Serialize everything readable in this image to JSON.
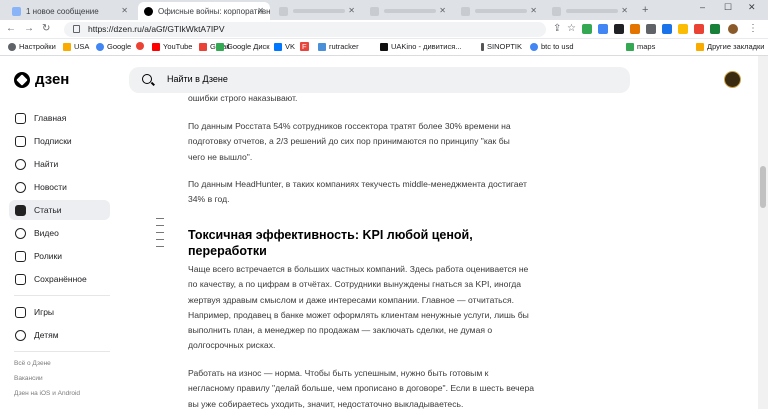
{
  "browser": {
    "tabs": [
      {
        "title": "1 новое сообщение",
        "favicon_color": "#8ab4f8"
      },
      {
        "title": "Офисные войны: корпоративн",
        "favicon_color": "#000000"
      },
      {
        "title": "",
        "favicon_color": "#9aa0a6"
      },
      {
        "title": "",
        "favicon_color": "#9aa0a6"
      },
      {
        "title": "",
        "favicon_color": "#9aa0a6"
      },
      {
        "title": "",
        "favicon_color": "#9aa0a6"
      }
    ],
    "new_tab": "+",
    "window_controls": {
      "minimize": "–",
      "maximize": "☐",
      "close": "✕"
    },
    "url": "https://dzen.ru/a/aGf/GTIkWktA7IPV",
    "bookmarks": [
      {
        "label": "Настройки",
        "color": "#5f6368"
      },
      {
        "label": "USA",
        "color": "#f9ab00"
      },
      {
        "label": "Google",
        "color": "#4285f4"
      },
      {
        "label": "",
        "color": "#ea4335"
      },
      {
        "label": "YouTube",
        "color": "#ff0000"
      },
      {
        "label": "Gmail",
        "color": "#ea4335"
      },
      {
        "label": "Google Диск",
        "color": "#34a853"
      },
      {
        "label": "VK",
        "color": "#0077ff"
      },
      {
        "label": "F",
        "color": "#e8453c"
      },
      {
        "label": "rutracker",
        "color": "#4a90d9"
      },
      {
        "label": "UAKino - дивитися...",
        "color": "#111111"
      },
      {
        "label": "SINOPTIK",
        "color": "#555555"
      },
      {
        "label": "btc to usd",
        "color": "#4285f4"
      },
      {
        "label": "maps",
        "color": "#34a853"
      }
    ],
    "other_bookmarks": "Другие закладки"
  },
  "app": {
    "logo_text": "дзен",
    "search_placeholder": "Найти в Дзене"
  },
  "sidebar": {
    "items": [
      {
        "label": "Главная",
        "icon": "home-icon"
      },
      {
        "label": "Подписки",
        "icon": "subscriptions-icon"
      },
      {
        "label": "Найти",
        "icon": "search-icon"
      },
      {
        "label": "Новости",
        "icon": "news-icon"
      },
      {
        "label": "Статьи",
        "icon": "articles-icon",
        "active": true
      },
      {
        "label": "Видео",
        "icon": "video-icon"
      },
      {
        "label": "Ролики",
        "icon": "clips-icon"
      },
      {
        "label": "Сохранённое",
        "icon": "bookmark-icon"
      },
      {
        "label": "Игры",
        "icon": "games-icon"
      },
      {
        "label": "Детям",
        "icon": "kids-icon"
      }
    ],
    "footer": [
      "Всё о Дзене",
      "Вакансии",
      "Дзен на iOS и Android"
    ]
  },
  "article": {
    "p0": "ошибки строго наказывают.",
    "p1": "По данным Росстата 54% сотрудников госсектора тратят более 30% времени на\nподготовку отчетов, а 2/3 решений до сих пор принимаются по принципу \"как бы\nчего не вышло\".",
    "p2": "По данным HeadHunter, в таких компаниях текучесть middle-менеджмента достигает\n34% в год.",
    "h2": "Токсичная эффективность: KPI любой ценой,\nпереработки",
    "p3": "Чаще всего встречается в больших частных компаний. Здесь работа оценивается не\nпо качеству, а по цифрам в отчётах. Сотрудники вынуждены гнаться за KPI, иногда\nжертвуя здравым смыслом и даже интересами компании. Главное — отчитаться.\nНапример, продавец в банке может оформлять клиентам ненужные услуги, лишь бы\nвыполнить план, а менеджер по продажам — заключать сделки, не думая о\nдолгосрочных рисках.",
    "p4": "Работать на износ — норма. Чтобы быть успешным, нужно быть готовым к\nнегласному правилу \"делай больше, чем прописано в договоре\". Если в шесть вечера\nвы уже собираетесь уходить, значит, недостаточно выкладываетесь."
  }
}
